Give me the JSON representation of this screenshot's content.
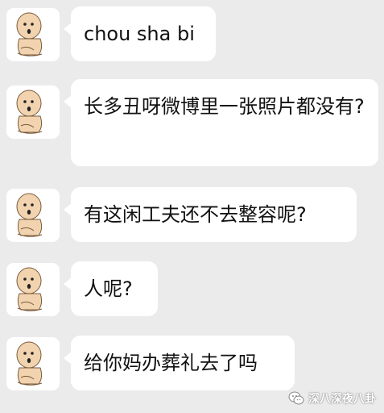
{
  "chat": {
    "messages": [
      {
        "text": "chou sha bi"
      },
      {
        "text": "长多丑呀微博里一张照片都没有?"
      },
      {
        "text": "有这闲工夫还不去整容呢?"
      },
      {
        "text": "人呢?"
      },
      {
        "text": "给你妈办葬礼去了吗"
      }
    ]
  },
  "watermark": {
    "text": "深八深夜八卦",
    "icon": "wechat-icon"
  },
  "colors": {
    "background": "#ebebeb",
    "bubble": "#ffffff",
    "text": "#111111"
  }
}
